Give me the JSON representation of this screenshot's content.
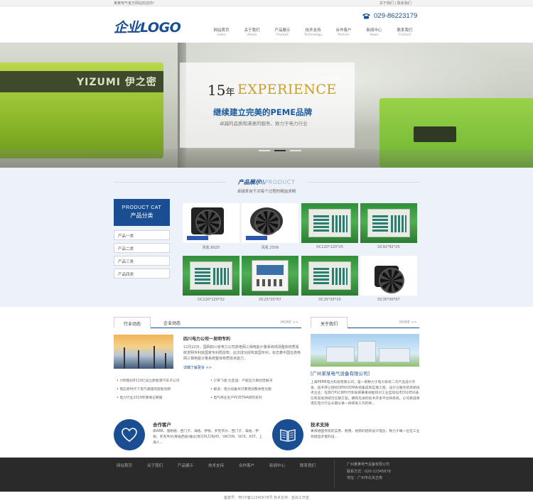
{
  "topbar": {
    "welcome": "某某电气官方网站欢迎你！",
    "links": "关于我们 | 联系我们"
  },
  "header": {
    "logo": "企业LOGO",
    "phone": "029-86223179",
    "nav": [
      {
        "cn": "网站首页",
        "en": "Index"
      },
      {
        "cn": "关于我们",
        "en": "About"
      },
      {
        "cn": "产品展示",
        "en": "Product"
      },
      {
        "cn": "技术支持",
        "en": "Technology"
      },
      {
        "cn": "合作客户",
        "en": "Partner"
      },
      {
        "cn": "新闻中心",
        "en": "News"
      },
      {
        "cn": "联系我们",
        "en": "Contact"
      }
    ]
  },
  "banner": {
    "years": "15",
    "year_unit": "年",
    "experience": "EXPERIENCE",
    "slogan": "继续建立完美的PEME品牌",
    "sub": "卓越的品质和满意的服务，致力于电力行业",
    "machine_text": "YIZUMI 伊之密"
  },
  "products": {
    "title_cn": "产品展示",
    "title_sep": "\\\\",
    "title_en": "PRODUCT",
    "subtitle": "卓越来自于对每个过程的精益求精",
    "cat_en": "PRODUCT CAT",
    "cat_cn": "产品分类",
    "categories": [
      "产品一类",
      "产品二类",
      "产品三类",
      "产品四类"
    ],
    "items": [
      {
        "caption": "风机 8025",
        "kind": "fan-square"
      },
      {
        "caption": "风机 2509",
        "kind": "fan-round"
      },
      {
        "caption": "DC120*120*25",
        "kind": "green-device"
      },
      {
        "caption": "DC92*92*25",
        "kind": "green-device"
      },
      {
        "caption": "DC120*120*32",
        "kind": "green-device"
      },
      {
        "caption": "DC25*25*07",
        "kind": "blue-meter"
      },
      {
        "caption": "DC25*25*10",
        "kind": "green-device"
      },
      {
        "caption": "DC30*30*07",
        "kind": "fan-small"
      }
    ]
  },
  "news": {
    "tab1": "行业动态",
    "tab2": "企业动态",
    "more": "MORE >>",
    "headline": "四川电力公司一发明专利",
    "body": "12月22日，国网四川省电力公司高电网三相电能计量系统现场整体校质系统发明专利获国家专利局授权。此次成功授权其国专利，标志着中国在高电网三相电能计量系统整体校质技术能力...",
    "detail": "详细了解更多 >>",
    "list": [
      "力积股份8110亿设立新能源汽车子公司",
      "订单飞涨 比亚迪：产能压力再创佳解决",
      "电压新时代下电气基建的智能创新",
      "解读：电力设备并可要增加整体性化服",
      "电力行业2019年要闻记要篇",
      "电气商业生产PLYETRA研究系列"
    ]
  },
  "about": {
    "tab": "关于我们",
    "more": "MORE >>",
    "company": "[广州某某电气设备有限公司]",
    "body": "上海PEME电力科技有限公司，是一家致力于电力系统二次产品设计开发、技术转让授权OEM/ODM系统集成和实施工程、设计与服务的高新技术企业；在高行PLC新时代和发挥著重视能和对工业自动化IEC61850通信和其他领域可信赖方案，拥有先进的技术开发平台和系统。公司真诚承诺在电力行业长期从事一线研发工作的将..."
  },
  "partners": {
    "title": "合作客户",
    "body": "库ABB、施耐德、西门子、海格、伊顿、罗克韦尔、西门子、海格、伊顿、罗克韦尔/库柏西屋/维达/南方PLC/RJ45、VACON、SICK、KST、上海人..."
  },
  "support": {
    "title": "技术支持",
    "body": "秉承德国传统的实用、耐用、视频的结构设计理念，致力于每一位在工业领域追求者的设..."
  },
  "footer": {
    "nav": [
      "网站首页",
      "关于我们",
      "产品展示",
      "技术支持",
      "合作客户",
      "新闻中心",
      "联系我们"
    ],
    "company": "广州某某电气设备有限公司",
    "phone": "联系方式：020-12345678",
    "address": "地址：广州市北关正南",
    "copyright": "备案号：粤ICP备12345678号   技术支持：蓝尚工作室"
  },
  "colors": {
    "brand": "#1a4e92",
    "gold": "#c99e2a",
    "footer": "#2a2a2a"
  }
}
